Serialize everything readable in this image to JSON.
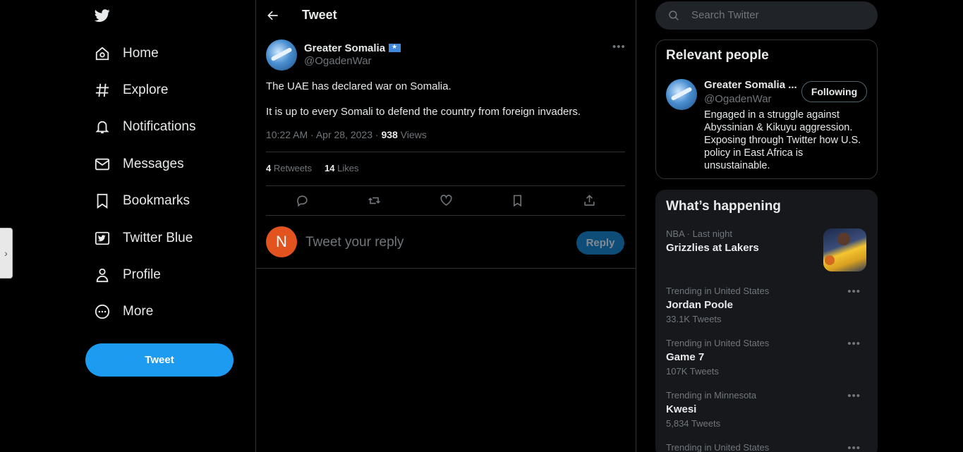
{
  "nav": {
    "items": [
      {
        "label": "Home",
        "icon": "home-icon"
      },
      {
        "label": "Explore",
        "icon": "hashtag-icon"
      },
      {
        "label": "Notifications",
        "icon": "bell-icon"
      },
      {
        "label": "Messages",
        "icon": "envelope-icon"
      },
      {
        "label": "Bookmarks",
        "icon": "bookmark-icon"
      },
      {
        "label": "Twitter Blue",
        "icon": "twitter-blue-icon"
      },
      {
        "label": "Profile",
        "icon": "person-icon"
      },
      {
        "label": "More",
        "icon": "more-circle-icon"
      }
    ],
    "tweet_button": "Tweet"
  },
  "header": {
    "title": "Tweet"
  },
  "tweet": {
    "author_name": "Greater Somalia",
    "author_handle": "@OgadenWar",
    "text_line1": "The UAE has declared war on Somalia.",
    "text_line2": "It is up to every Somali to defend the country from foreign invaders.",
    "time": "10:22 AM · Apr 28, 2023 · ",
    "views_count": "938",
    "views_label": " Views",
    "retweets_count": "4",
    "retweets_label": " Retweets",
    "likes_count": "14",
    "likes_label": " Likes"
  },
  "reply": {
    "avatar_letter": "N",
    "placeholder": "Tweet your reply",
    "button": "Reply"
  },
  "search": {
    "placeholder": "Search Twitter"
  },
  "relevant_people": {
    "title": "Relevant people",
    "name": "Greater Somalia ...",
    "handle": "@OgadenWar",
    "follow_label": "Following",
    "bio": "Engaged in a struggle against Abyssinian & Kikuyu aggression. Exposing through Twitter how U.S. policy in East Africa is unsustainable."
  },
  "whats_happening": {
    "title": "What’s happening",
    "trends": [
      {
        "context": "NBA · Last night",
        "name": "Grizzlies at Lakers",
        "count": ""
      },
      {
        "context": "Trending in United States",
        "name": "Jordan Poole",
        "count": "33.1K Tweets"
      },
      {
        "context": "Trending in United States",
        "name": "Game 7",
        "count": "107K Tweets"
      },
      {
        "context": "Trending in Minnesota",
        "name": "Kwesi",
        "count": "5,834 Tweets"
      },
      {
        "context": "Trending in United States",
        "name": "",
        "count": ""
      }
    ]
  },
  "colors": {
    "accent": "#1d9bf0",
    "background": "#000000",
    "muted": "#71767b",
    "border": "#2f3336"
  }
}
